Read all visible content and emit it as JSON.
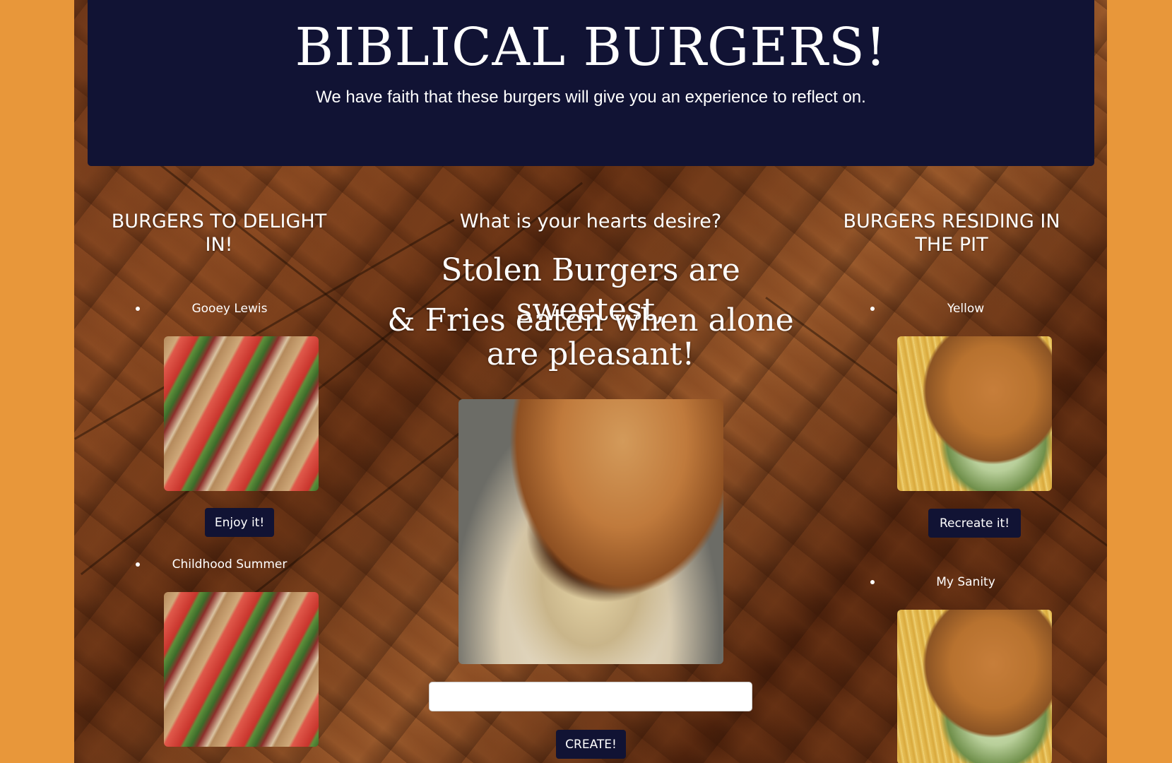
{
  "header": {
    "title": "BIBLICAL BURGERS!",
    "tagline": "We have faith that these burgers will give you an experience to reflect on."
  },
  "left_column": {
    "title": "BURGERS TO DELIGHT IN!",
    "items": [
      {
        "name": "Gooey Lewis",
        "button": "Enjoy it!"
      },
      {
        "name": "Childhood Summer"
      }
    ]
  },
  "center_column": {
    "title": "What is your hearts desire?",
    "quote_line1": "Stolen Burgers are sweetest,",
    "quote_line2": "& Fries eaten when alone are pleasant!",
    "input_value": "",
    "input_placeholder": "",
    "create_button": "CREATE!"
  },
  "right_column": {
    "title": "BURGERS RESIDING IN THE PIT",
    "items": [
      {
        "name": "Yellow",
        "button": "Recreate it!"
      },
      {
        "name": "My Sanity"
      }
    ]
  },
  "colors": {
    "page_background": "#E8973A",
    "header_background": "#111334",
    "button_background": "#111334",
    "text": "#ffffff"
  }
}
